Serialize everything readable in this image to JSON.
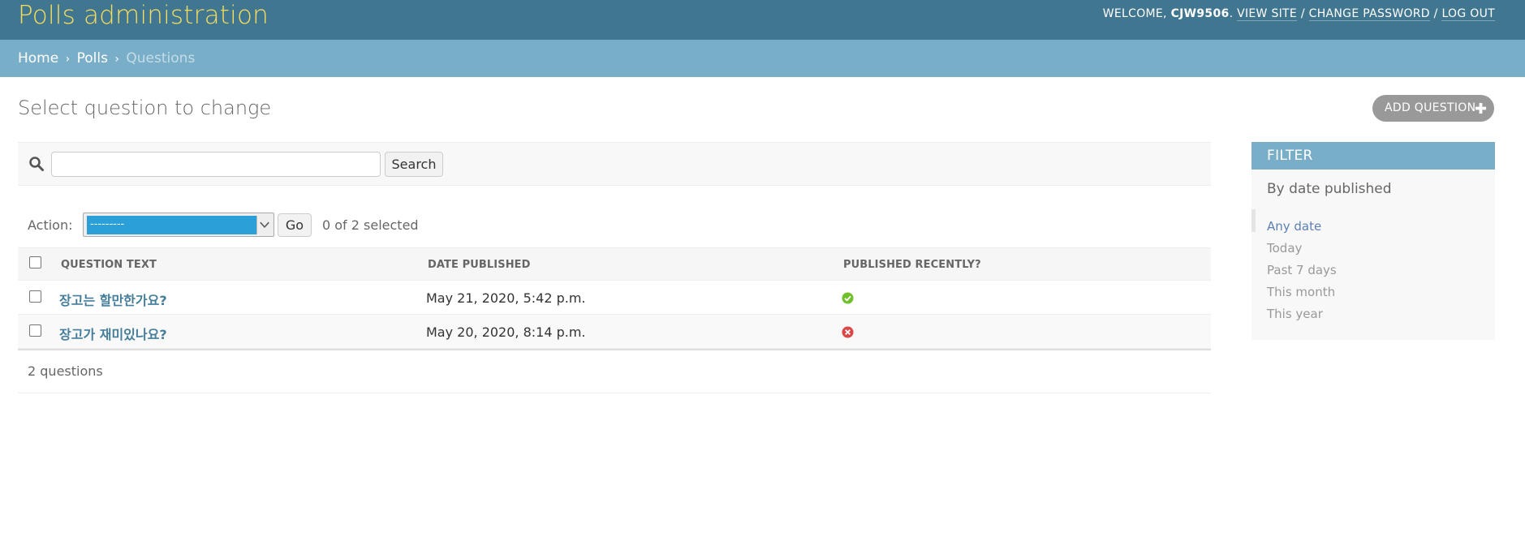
{
  "header": {
    "site_title": "Polls administration",
    "welcome": "WELCOME,",
    "username": "CJW9506",
    "view_site": "VIEW SITE",
    "change_password": "CHANGE PASSWORD",
    "log_out": "LOG OUT",
    "separator": "/"
  },
  "breadcrumbs": {
    "home": "Home",
    "app": "Polls",
    "current": "Questions",
    "separator": "›"
  },
  "page": {
    "title": "Select question to change",
    "add_button": "ADD QUESTION"
  },
  "search": {
    "value": "",
    "placeholder": "",
    "button": "Search"
  },
  "actions": {
    "label": "Action:",
    "selected": "---------",
    "go": "Go",
    "counter": "0 of 2 selected"
  },
  "table": {
    "columns": [
      "QUESTION TEXT",
      "DATE PUBLISHED",
      "PUBLISHED RECENTLY?"
    ],
    "rows": [
      {
        "question": "장고는 할만한가요?",
        "date": "May 21, 2020, 5:42 p.m.",
        "recent": true
      },
      {
        "question": "장고가 재미있나요?",
        "date": "May 20, 2020, 8:14 p.m.",
        "recent": false
      }
    ]
  },
  "paginator": "2 questions",
  "filter": {
    "heading": "FILTER",
    "subheading": "By date published",
    "options": [
      "Any date",
      "Today",
      "Past 7 days",
      "This month",
      "This year"
    ],
    "selected_index": 0
  },
  "colors": {
    "header_bg": "#417690",
    "branding": "#f5dd5d",
    "breadcrumb_bg": "#79aec8",
    "link": "#447e9b",
    "true_icon": "#70bf2b",
    "false_icon": "#dd4646"
  },
  "icons": {
    "search": "search-icon",
    "add": "plus-icon",
    "true": "check-circle-icon",
    "false": "x-circle-icon"
  }
}
